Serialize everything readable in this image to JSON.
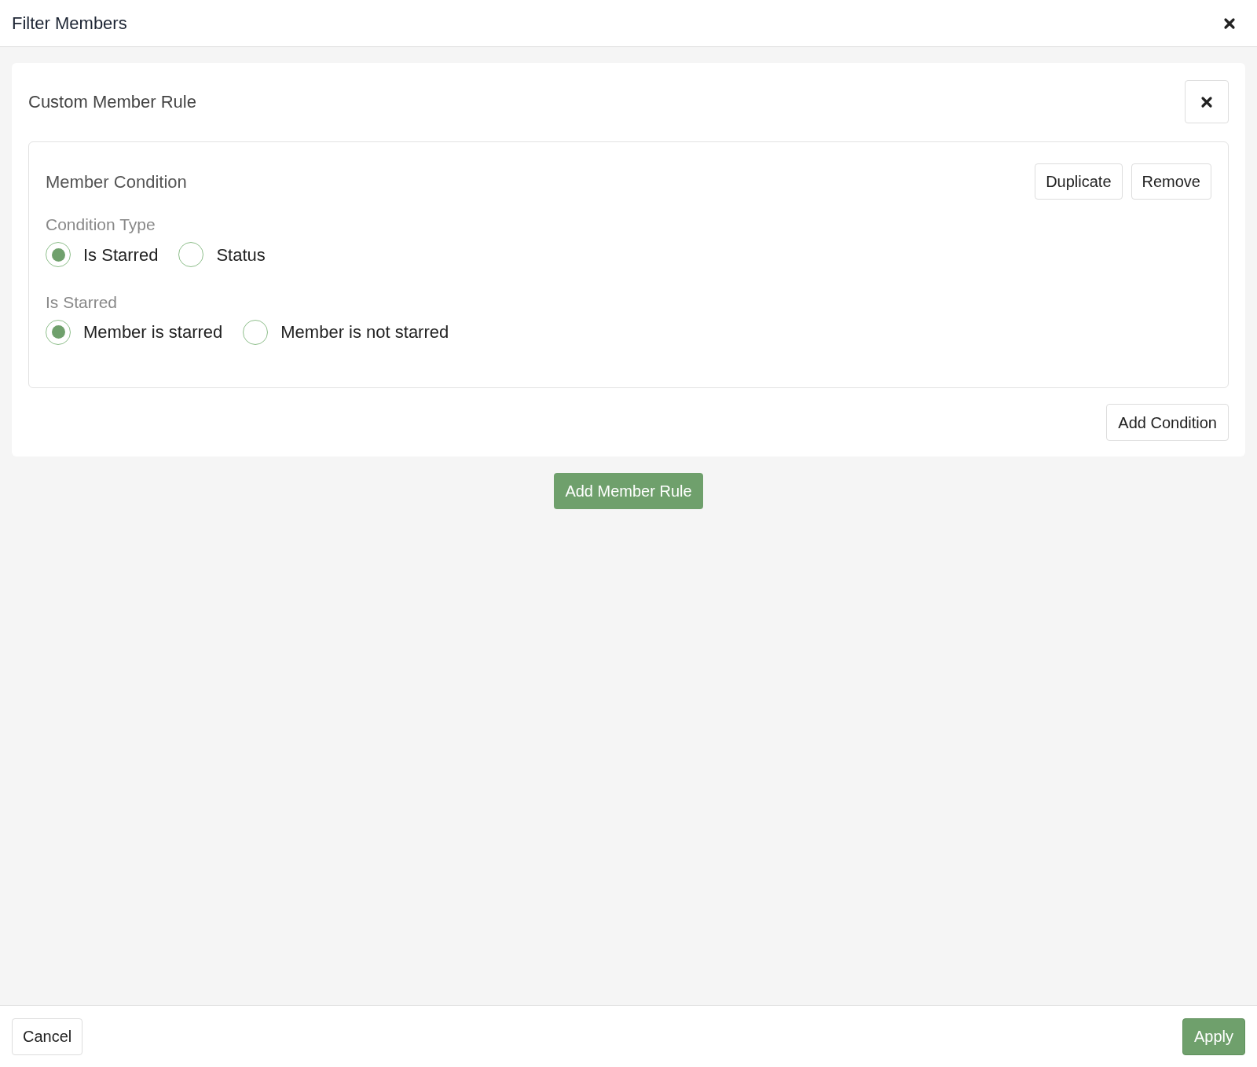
{
  "dialog": {
    "title": "Filter Members"
  },
  "rule": {
    "title": "Custom Member Rule",
    "condition": {
      "title": "Member Condition",
      "actions": [
        "Duplicate",
        "Remove"
      ],
      "groups": [
        {
          "label": "Condition Type",
          "options": [
            {
              "label": "Is Starred",
              "selected": true
            },
            {
              "label": "Status",
              "selected": false
            }
          ]
        },
        {
          "label": "Is Starred",
          "options": [
            {
              "label": "Member is starred",
              "selected": true
            },
            {
              "label": "Member is not starred",
              "selected": false
            }
          ]
        }
      ]
    },
    "add_condition": "Add Condition"
  },
  "add_rule": "Add Member Rule",
  "footer": {
    "cancel": "Cancel",
    "apply": "Apply"
  }
}
